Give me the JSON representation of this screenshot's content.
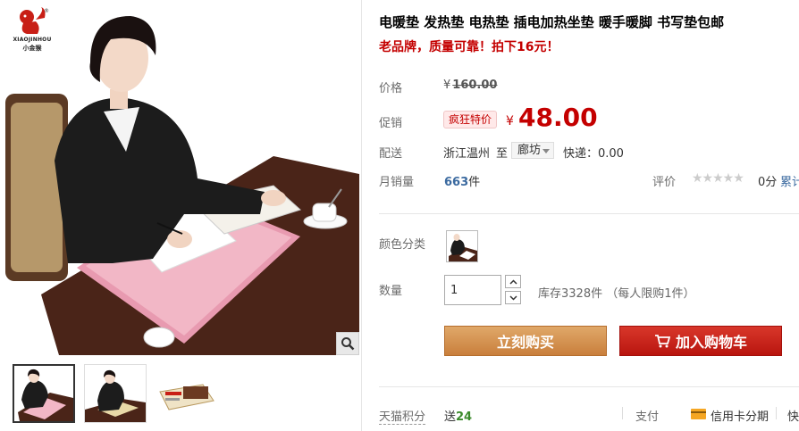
{
  "brand": {
    "latin": "XIAOJINHOU",
    "cn": "小金猴",
    "registered": "®"
  },
  "product": {
    "title": "电暖垫 发热垫 电热垫 插电加热坐垫 暖手暖脚 书写垫包邮",
    "subtitle": "老品牌，质量可靠！拍下16元！"
  },
  "price": {
    "label": "价格",
    "currency": "¥",
    "original": "160.00"
  },
  "promo": {
    "label": "促销",
    "badge": "疯狂特价",
    "currency": "¥",
    "price": "48.00"
  },
  "shipping": {
    "label": "配送",
    "from": "浙江温州",
    "to_word": "至",
    "to_city": "廊坊",
    "express": "快递：0.00"
  },
  "sales": {
    "label": "月销量",
    "count": "663",
    "unit": "件",
    "review_label": "评价",
    "stars": "★★★★★",
    "score": "0分",
    "cumulative": "累计"
  },
  "color": {
    "label": "颜色分类"
  },
  "quantity": {
    "label": "数量",
    "value": "1",
    "stock": "库存3328件 （每人限购1件）"
  },
  "actions": {
    "buy_now": "立刻购买",
    "add_to_cart": "加入购物车"
  },
  "footer": {
    "points_label": "天猫积分",
    "points_prefix": "送",
    "points_value": "24",
    "pay_label": "支付",
    "pay_credit": "信用卡分期",
    "pay_more": "快"
  },
  "colors": {
    "accent_red": "#c40000",
    "buy_orange": "#d9944f",
    "cart_red": "#c81f16",
    "link_blue": "#3b6aa0"
  }
}
